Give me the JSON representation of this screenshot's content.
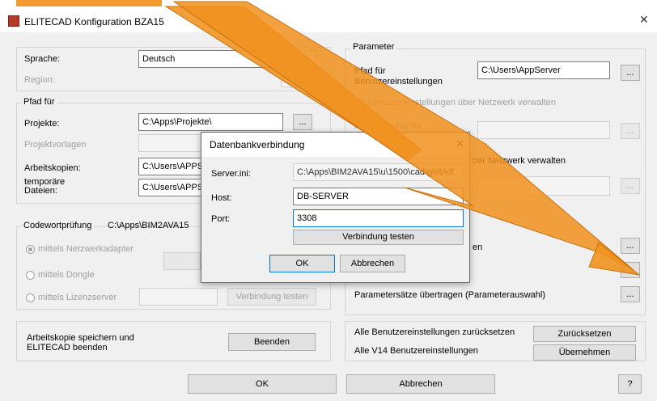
{
  "window": {
    "title": "ELITECAD Konfiguration BZA15",
    "close_glyph": "✕"
  },
  "left": {
    "sprache_label": "Sprache:",
    "sprache_value": "Deutsch",
    "sprache_code": "de",
    "region_label": "Region:",
    "pfad_group": "Pfad für",
    "projekte_label": "Projekte:",
    "projekte_value": "C:\\Apps\\Projekte\\",
    "projektvorlagen_label": "Projektvorlagen",
    "arbeitskopien_label": "Arbeitskopien:",
    "arbeitskopien_value": "C:\\Users\\APPSE",
    "temp_label_1": "temporäre",
    "temp_label_2": "Dateien:",
    "temp_value": "C:\\Users\\APPSE",
    "browse_label": "...",
    "code_group": "Codewortprüfung",
    "code_path": "C:\\Apps\\BIM2AVA15",
    "radio_netz": "mittels Netzwerkadapter",
    "radio_dongle": "mittels Dongle",
    "radio_lizenz": "mittels Lizenzserver",
    "verbindung_label": "Verbindung testen",
    "arbeitskopie_1": "Arbeitskopie speichern und",
    "arbeitskopie_2": "ELITECAD beenden",
    "beenden_label": "Beenden"
  },
  "right": {
    "parameter_group": "Parameter",
    "pfad_label_1": "Pfad für",
    "pfad_label_2": "Benutzereinstellungen",
    "pfad_value": "C:\\Users\\AppServer",
    "browse_label": "...",
    "netz_check_label": "Benutzereinstellungen über Netzwerk verwalten",
    "netzpfad_label": "Netzwerkpfad für",
    "netz2_label": "ber Netzwerk verwalten",
    "en_label": "en",
    "parametersaetze_label": "Parametersätze übertragen (Parameterauswahl)",
    "reset_label": "Alle Benutzereinstellungen zurücksetzen",
    "reset_btn": "Zurücksetzen",
    "v14_label": "Alle V14 Benutzereinstellungen",
    "v14_btn": "Übernehmen"
  },
  "footer": {
    "ok": "OK",
    "abbrechen": "Abbrechen",
    "help": "?"
  },
  "dialog": {
    "title": "Datenbankverbindung",
    "close_glyph": "✕",
    "server_label": "Server.ini:",
    "server_value": "C:\\Apps\\BIM2AVA15\\u\\1500\\cad\\glob\\df",
    "host_label": "Host:",
    "host_value": "DB-SERVER",
    "port_label": "Port:",
    "port_value": "3308",
    "test_btn": "Verbindung testen",
    "ok_btn": "OK",
    "cancel_btn": "Abbrechen"
  },
  "colors": {
    "arrow": "#f0921e",
    "arrow_edge": "#c9700f"
  }
}
